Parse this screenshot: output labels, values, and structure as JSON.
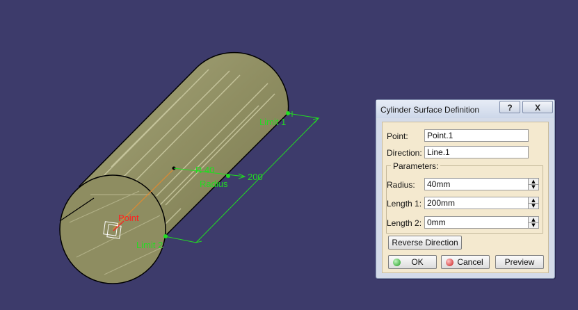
{
  "viewport": {
    "labels": {
      "limit1": "Limit 1",
      "limit2": "Limit 2",
      "radius": "Radius",
      "radius_value": "R 40",
      "length_value": "200",
      "point": "Point"
    },
    "colors": {
      "background": "#3d3b6b",
      "surface": "#8b8a5e",
      "annotation": "#22dd22",
      "point_label": "#ff2020"
    }
  },
  "dialog": {
    "title": "Cylinder Surface Definition",
    "help_icon": "?",
    "close_icon": "X",
    "point_label": "Point:",
    "point_value": "Point.1",
    "direction_label": "Direction:",
    "direction_value": "Line.1",
    "parameters_title": "Parameters:",
    "radius_label": "Radius:",
    "radius_value": "40mm",
    "length1_label": "Length 1:",
    "length1_value": "200mm",
    "length2_label": "Length 2:",
    "length2_value": "0mm",
    "reverse_label": "Reverse Direction",
    "ok_label": "OK",
    "cancel_label": "Cancel",
    "preview_label": "Preview"
  }
}
